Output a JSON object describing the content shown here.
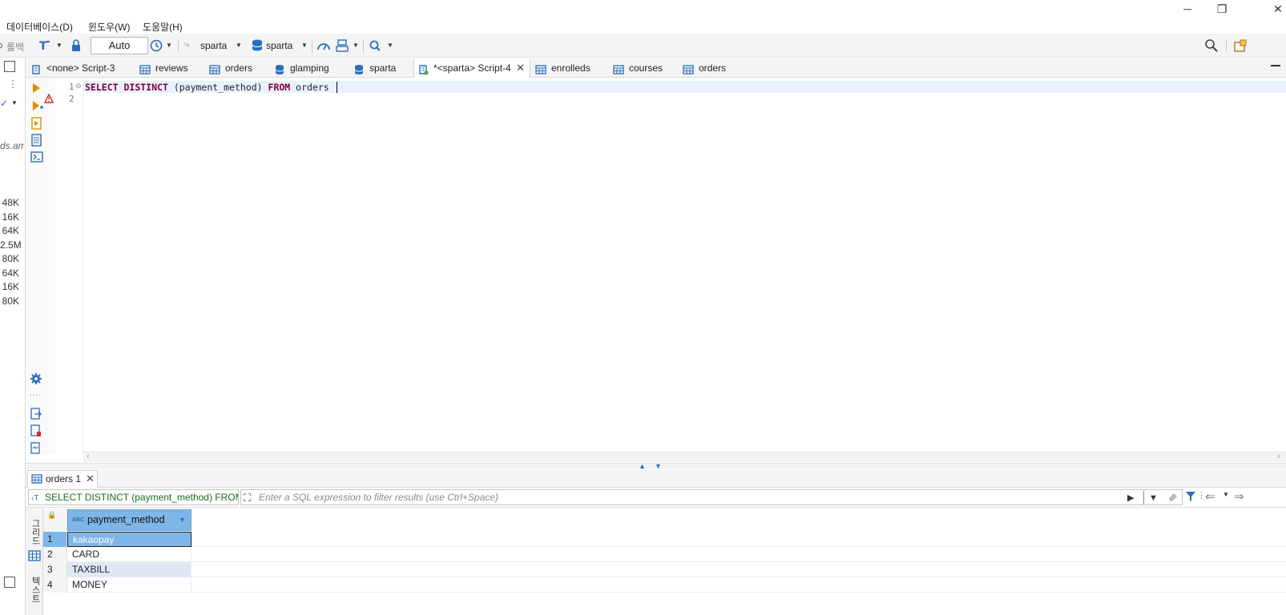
{
  "menu": {
    "items": [
      "데이터베이스(D)",
      "윈도우(W)",
      "도움말(H)"
    ]
  },
  "toolbar": {
    "rollback_label": "롤백",
    "transaction_mode": "Auto",
    "datasource_label": "sparta",
    "schema_label": "sparta"
  },
  "left_panel": {
    "truncated_text": "ds.am",
    "sizes": [
      "48K",
      "16K",
      "64K",
      "2.5M",
      "80K",
      "64K",
      "16K",
      "80K"
    ]
  },
  "editor_tabs": [
    {
      "label": "<none> Script-3",
      "icon": "script-icon"
    },
    {
      "label": "reviews",
      "icon": "table-icon"
    },
    {
      "label": "orders",
      "icon": "table-icon"
    },
    {
      "label": "glamping",
      "icon": "database-icon"
    },
    {
      "label": "sparta",
      "icon": "database-icon"
    },
    {
      "label": "*<sparta> Script-4",
      "icon": "script-icon",
      "active": true
    },
    {
      "label": "enrolleds",
      "icon": "table-icon"
    },
    {
      "label": "courses",
      "icon": "table-icon"
    },
    {
      "label": "orders",
      "icon": "table-icon"
    }
  ],
  "editor": {
    "line_numbers": [
      "1",
      "2"
    ],
    "sql": {
      "kw1": "SELECT",
      "kw2": "DISTINCT",
      "arg": "(payment_method)",
      "kw3": "FROM",
      "table": "orders"
    }
  },
  "results": {
    "tab_label": "orders 1",
    "query_preview": "SELECT DISTINCT (payment_method) FROM o",
    "filter_placeholder": "Enter a SQL expression to filter results (use Ctrl+Space)",
    "column": {
      "name": "payment_method",
      "type_badge": "ABC"
    },
    "rows": [
      {
        "num": "1",
        "value": "kakaopay"
      },
      {
        "num": "2",
        "value": "CARD"
      },
      {
        "num": "3",
        "value": "TAXBILL"
      },
      {
        "num": "4",
        "value": "MONEY"
      }
    ],
    "side_tabs": [
      "그리드",
      "텍스트"
    ]
  },
  "colors": {
    "accent_blue": "#1e7fd0",
    "selection_blue": "#7fb6e8",
    "keyword": "#7a0033",
    "run_orange": "#e68a00"
  }
}
